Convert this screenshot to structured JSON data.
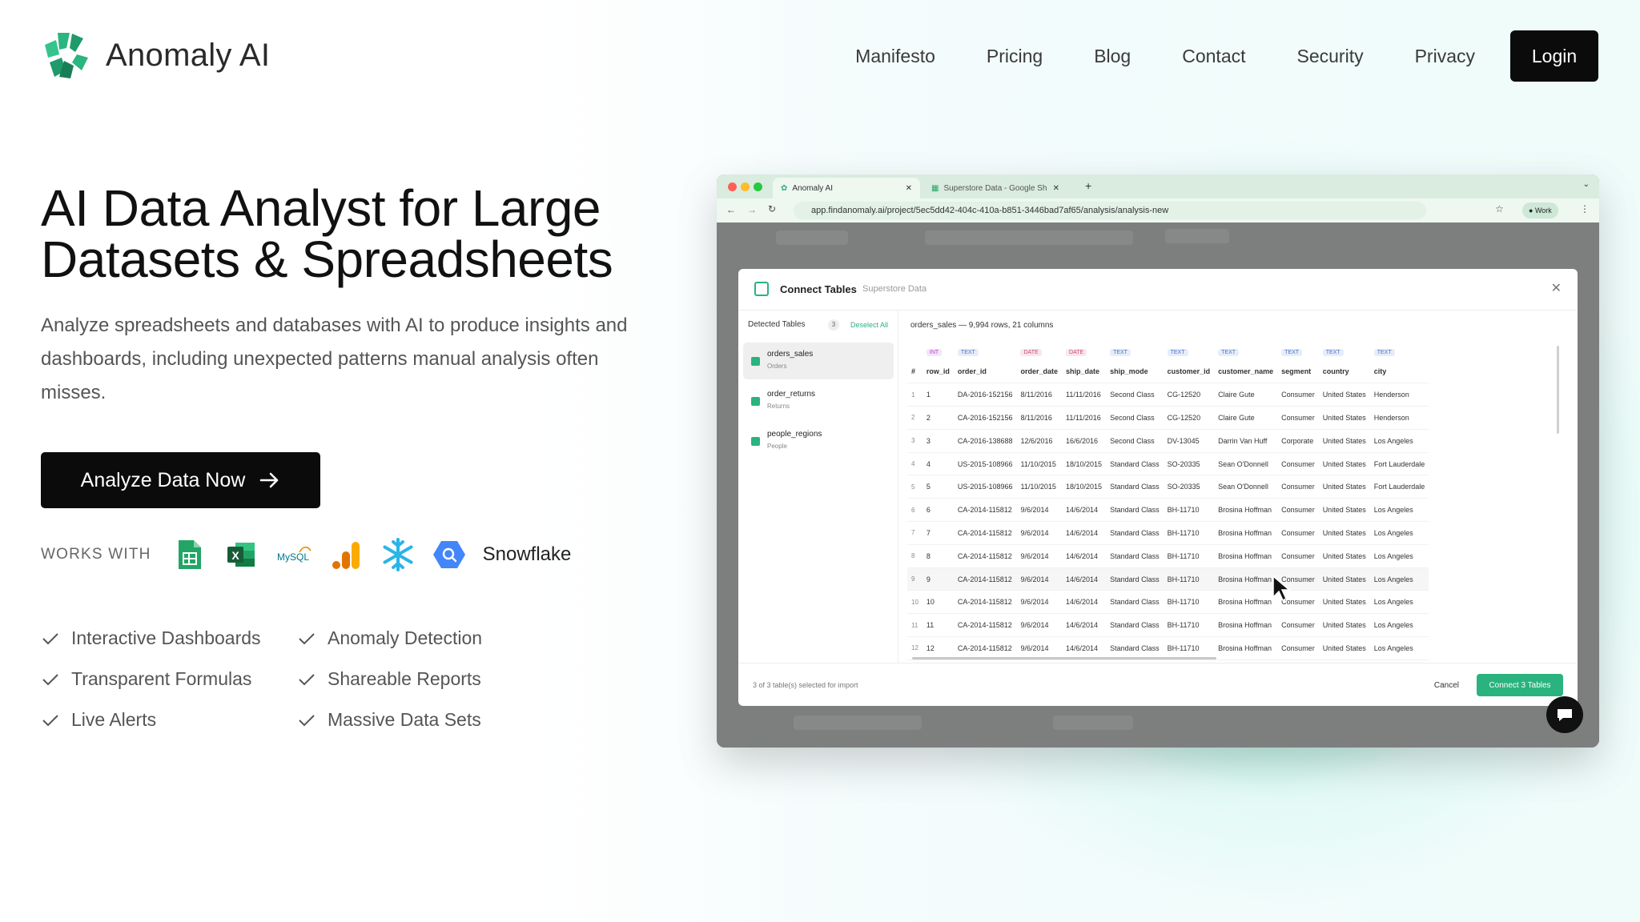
{
  "brand": {
    "name": "Anomaly AI",
    "logo_color": "#2bb57f"
  },
  "nav": {
    "links": [
      "Manifesto",
      "Pricing",
      "Blog",
      "Contact",
      "Security",
      "Privacy"
    ],
    "login": "Login"
  },
  "hero": {
    "title_line1": "AI Data Analyst for Large",
    "title_line2": "Datasets & Spreadsheets",
    "subtitle": "Analyze spreadsheets and databases with AI to produce insights and dashboards, including unexpected patterns manual analysis often misses.",
    "cta": "Analyze Data Now"
  },
  "works_with": {
    "label": "WORKS WITH",
    "icons": [
      "google-sheets-icon",
      "excel-icon",
      "mysql-icon",
      "google-analytics-icon",
      "snowflake-icon",
      "bigquery-icon"
    ],
    "mysql_text": "MySQL",
    "excel_text": "X",
    "snowflake_text": "Snowflake"
  },
  "features": [
    "Interactive Dashboards",
    "Anomaly Detection",
    "Transparent Formulas",
    "Shareable Reports",
    "Live Alerts",
    "Massive Data Sets"
  ],
  "browser": {
    "tab1": "Anomaly AI",
    "tab2": "Superstore Data - Google Sh",
    "url": "app.findanomaly.ai/project/5ec5dd42-404c-410a-b851-3446bad7af65/analysis/analysis-new",
    "profile": "Work",
    "modal": {
      "title": "Connect Tables",
      "subtitle": "Superstore Data",
      "detected_label": "Detected Tables",
      "detected_count": "3",
      "deselect": "Deselect All",
      "tables": [
        {
          "name": "orders_sales",
          "alias": "Orders"
        },
        {
          "name": "order_returns",
          "alias": "Returns"
        },
        {
          "name": "people_regions",
          "alias": "People"
        }
      ],
      "grid_title": "orders_sales — 9,994 rows, 21 columns",
      "types": [
        "",
        "INT",
        "TEXT",
        "DATE",
        "DATE",
        "TEXT",
        "TEXT",
        "TEXT",
        "TEXT",
        "TEXT",
        "TEXT"
      ],
      "columns": [
        "#",
        "row_id",
        "order_id",
        "order_date",
        "ship_date",
        "ship_mode",
        "customer_id",
        "customer_name",
        "segment",
        "country",
        "city"
      ],
      "rows": [
        [
          "1",
          "1",
          "DA-2016-152156",
          "8/11/2016",
          "11/11/2016",
          "Second Class",
          "CG-12520",
          "Claire Gute",
          "Consumer",
          "United States",
          "Henderson"
        ],
        [
          "2",
          "2",
          "CA-2016-152156",
          "8/11/2016",
          "11/11/2016",
          "Second Class",
          "CG-12520",
          "Claire Gute",
          "Consumer",
          "United States",
          "Henderson"
        ],
        [
          "3",
          "3",
          "CA-2016-138688",
          "12/6/2016",
          "16/6/2016",
          "Second Class",
          "DV-13045",
          "Darrin Van Huff",
          "Corporate",
          "United States",
          "Los Angeles"
        ],
        [
          "4",
          "4",
          "US-2015-108966",
          "11/10/2015",
          "18/10/2015",
          "Standard Class",
          "SO-20335",
          "Sean O'Donnell",
          "Consumer",
          "United States",
          "Fort Lauderdale"
        ],
        [
          "5",
          "5",
          "US-2015-108966",
          "11/10/2015",
          "18/10/2015",
          "Standard Class",
          "SO-20335",
          "Sean O'Donnell",
          "Consumer",
          "United States",
          "Fort Lauderdale"
        ],
        [
          "6",
          "6",
          "CA-2014-115812",
          "9/6/2014",
          "14/6/2014",
          "Standard Class",
          "BH-11710",
          "Brosina Hoffman",
          "Consumer",
          "United States",
          "Los Angeles"
        ],
        [
          "7",
          "7",
          "CA-2014-115812",
          "9/6/2014",
          "14/6/2014",
          "Standard Class",
          "BH-11710",
          "Brosina Hoffman",
          "Consumer",
          "United States",
          "Los Angeles"
        ],
        [
          "8",
          "8",
          "CA-2014-115812",
          "9/6/2014",
          "14/6/2014",
          "Standard Class",
          "BH-11710",
          "Brosina Hoffman",
          "Consumer",
          "United States",
          "Los Angeles"
        ],
        [
          "9",
          "9",
          "CA-2014-115812",
          "9/6/2014",
          "14/6/2014",
          "Standard Class",
          "BH-11710",
          "Brosina Hoffman",
          "Consumer",
          "United States",
          "Los Angeles"
        ],
        [
          "10",
          "10",
          "CA-2014-115812",
          "9/6/2014",
          "14/6/2014",
          "Standard Class",
          "BH-11710",
          "Brosina Hoffman",
          "Consumer",
          "United States",
          "Los Angeles"
        ],
        [
          "11",
          "11",
          "CA-2014-115812",
          "9/6/2014",
          "14/6/2014",
          "Standard Class",
          "BH-11710",
          "Brosina Hoffman",
          "Consumer",
          "United States",
          "Los Angeles"
        ],
        [
          "12",
          "12",
          "CA-2014-115812",
          "9/6/2014",
          "14/6/2014",
          "Standard Class",
          "BH-11710",
          "Brosina Hoffman",
          "Consumer",
          "United States",
          "Los Angeles"
        ]
      ],
      "footer_note": "3 of 3 table(s) selected for import",
      "cancel": "Cancel",
      "connect": "Connect 3 Tables"
    }
  },
  "colors": {
    "accent": "#2ab37e",
    "dark": "#0b0b0b",
    "glow": "#2fdea0"
  }
}
